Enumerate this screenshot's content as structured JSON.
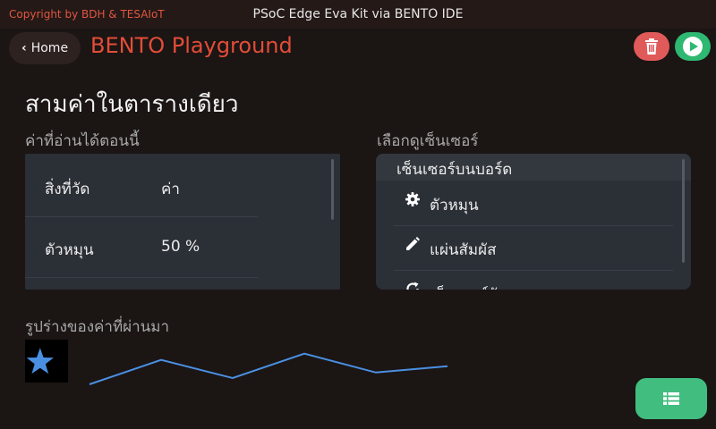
{
  "topbar": {
    "copyright": "Copyright by BDH & TESAIoT",
    "title": "PSoC Edge Eva Kit via BENTO IDE"
  },
  "header": {
    "home_label": "Home",
    "title": "BENTO Playground",
    "delete_icon": "trash-icon",
    "run_icon": "play-icon"
  },
  "main": {
    "heading": "สามค่าในตารางเดียว",
    "readings_title": "ค่าที่อ่านได้ตอนนี้",
    "readings_header": {
      "col1": "สิ่งที่วัด",
      "col2": "ค่า"
    },
    "readings_rows": [
      {
        "name": "ตัวหมุน",
        "value": "50 %"
      }
    ],
    "sensors_title": "เลือกดูเซ็นเซอร์",
    "sensors_group": "เซ็นเซอร์บนบอร์ด",
    "sensors": [
      {
        "icon": "gear-icon",
        "label": "ตัวหมุน"
      },
      {
        "icon": "pencil-icon",
        "label": "แผ่นสัมผัส"
      },
      {
        "icon": "refresh-icon",
        "label": "เซ็นเซอร์วัดการหมุน"
      }
    ],
    "history_title": "รูปร่างของค่าที่ผ่านมา",
    "history_icon": "star-icon",
    "history_values": [
      0,
      0.62,
      0.16,
      0.78,
      0.3,
      0.46
    ],
    "colors": {
      "accent": "#e24d38",
      "line": "#4a90e2",
      "run": "#2eb872",
      "delete": "#e05a5a",
      "fab": "#41bd7f"
    }
  },
  "fab": {
    "icon": "table-icon"
  }
}
